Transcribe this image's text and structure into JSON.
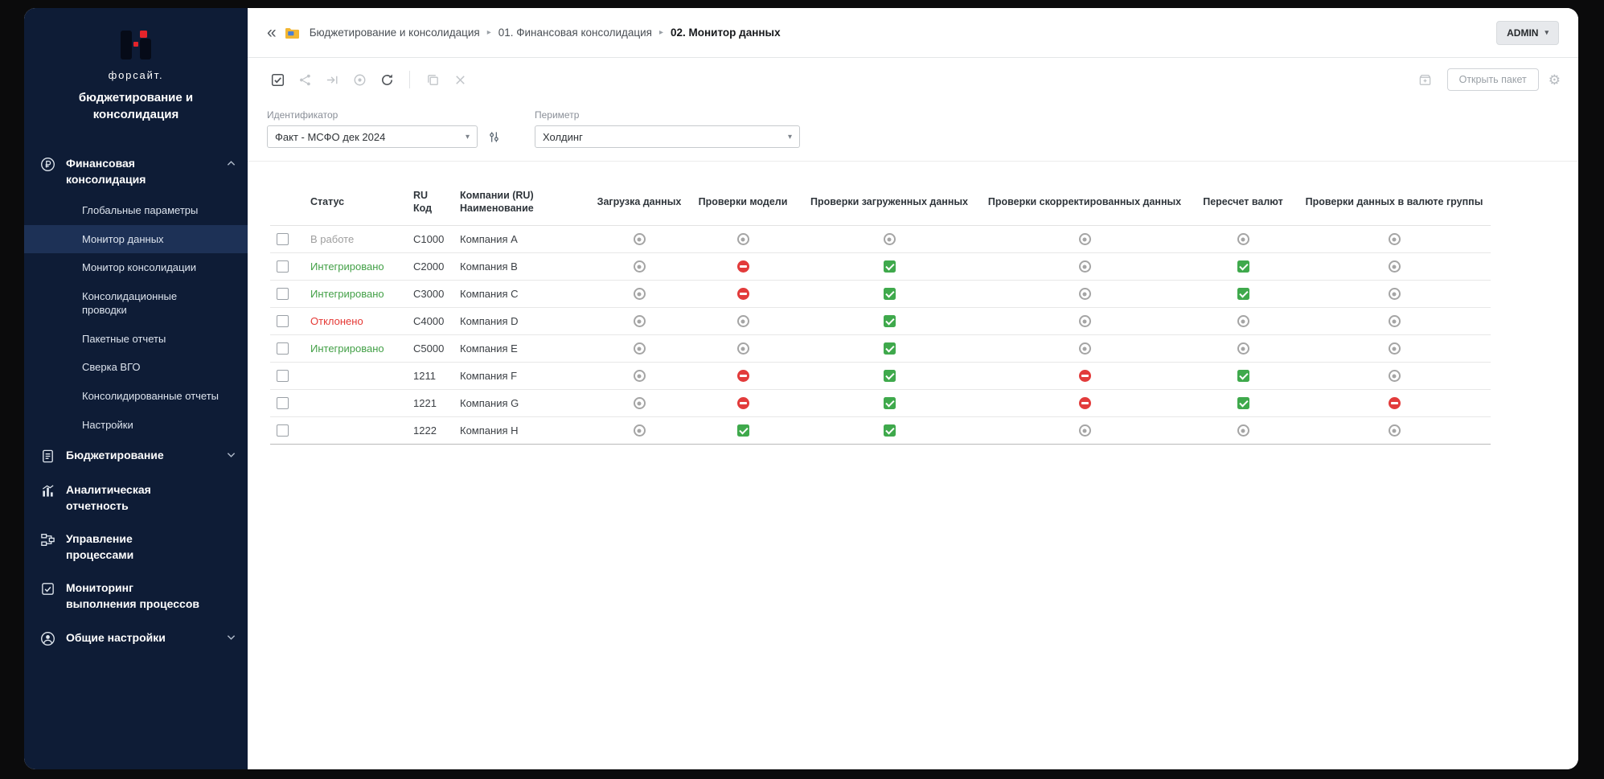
{
  "colors": {
    "accent_red": "#e3242b",
    "status_green": "#43a047",
    "status_red": "#e53935",
    "status_gray": "#9e9e9e",
    "sidebar_bg": "#0e1c36"
  },
  "sidebar": {
    "brand": "форсайт.",
    "product": "бюджетирование и консолидация",
    "menu": [
      {
        "id": "financial-consolidation",
        "icon": "ruble",
        "label": "Финансовая консолидация",
        "chevron": "up",
        "expanded": true,
        "children": [
          "Глобальные параметры",
          "Монитор данных",
          "Монитор консолидации",
          "Консолидационные проводки",
          "Пакетные отчеты",
          "Сверка ВГО",
          "Консолидированные отчеты",
          "Настройки"
        ],
        "active_child": "Монитор данных"
      },
      {
        "id": "budgeting",
        "icon": "document",
        "label": "Бюджетирование",
        "chevron": "down"
      },
      {
        "id": "analytical-reporting",
        "icon": "chart",
        "label": "Аналитическая отчетность"
      },
      {
        "id": "process-management",
        "icon": "process",
        "label": "Управление процессами"
      },
      {
        "id": "process-monitoring",
        "icon": "monitor",
        "label": "Мониторинг выполнения процессов"
      },
      {
        "id": "general-settings",
        "icon": "user",
        "label": "Общие настройки",
        "chevron": "down"
      }
    ]
  },
  "header": {
    "breadcrumb": [
      "Бюджетирование и консолидация",
      "01. Финансовая консолидация",
      "02. Монитор данных"
    ],
    "user_button": "ADMIN"
  },
  "toolbar": {
    "left_icons": [
      {
        "name": "select-rows",
        "state": "active"
      },
      {
        "name": "share",
        "state": "disabled"
      },
      {
        "name": "submit-forward",
        "state": "disabled"
      },
      {
        "name": "record-circle",
        "state": "disabled"
      },
      {
        "name": "refresh",
        "state": "active"
      },
      {
        "name": "divider"
      },
      {
        "name": "copy-package",
        "state": "disabled"
      },
      {
        "name": "close",
        "state": "disabled"
      }
    ],
    "open_package_label": "Открыть пакет"
  },
  "filters": {
    "identifier": {
      "label": "Идентификатор",
      "value": "Факт - МСФО дек 2024"
    },
    "perimeter": {
      "label": "Периметр",
      "value": "Холдинг"
    }
  },
  "table": {
    "columns": [
      "Статус",
      "RU Код",
      "Компании (RU) Наименование",
      "Загрузка данных",
      "Проверки модели",
      "Проверки загруженных данных",
      "Проверки скорректированных данных",
      "Пересчет валют",
      "Проверки данных в валюте группы"
    ],
    "rows": [
      {
        "status": "В работе",
        "status_kind": "in-progress",
        "code": "C1000",
        "company": "Компания A",
        "checks": [
          "pending",
          "pending",
          "pending",
          "pending",
          "pending",
          "pending"
        ]
      },
      {
        "status": "Интегрировано",
        "status_kind": "integrated",
        "code": "C2000",
        "company": "Компания B",
        "checks": [
          "pending",
          "blocked",
          "ok",
          "pending",
          "ok",
          "pending"
        ]
      },
      {
        "status": "Интегрировано",
        "status_kind": "integrated",
        "code": "C3000",
        "company": "Компания C",
        "checks": [
          "pending",
          "blocked",
          "ok",
          "pending",
          "ok",
          "pending"
        ]
      },
      {
        "status": "Отклонено",
        "status_kind": "rejected",
        "code": "C4000",
        "company": "Компания D",
        "checks": [
          "pending",
          "pending",
          "ok",
          "pending",
          "pending",
          "pending"
        ]
      },
      {
        "status": "Интегрировано",
        "status_kind": "integrated",
        "code": "C5000",
        "company": "Компания E",
        "checks": [
          "pending",
          "pending",
          "ok",
          "pending",
          "pending",
          "pending"
        ]
      },
      {
        "status": "",
        "status_kind": "none",
        "code": "1211",
        "company": "Компания F",
        "checks": [
          "pending",
          "blocked",
          "ok",
          "blocked",
          "ok",
          "pending"
        ]
      },
      {
        "status": "",
        "status_kind": "none",
        "code": "1221",
        "company": "Компания G",
        "checks": [
          "pending",
          "blocked",
          "ok",
          "blocked",
          "ok",
          "blocked"
        ]
      },
      {
        "status": "",
        "status_kind": "none",
        "code": "1222",
        "company": "Компания H",
        "checks": [
          "pending",
          "ok",
          "ok",
          "pending",
          "pending",
          "pending"
        ]
      }
    ]
  }
}
